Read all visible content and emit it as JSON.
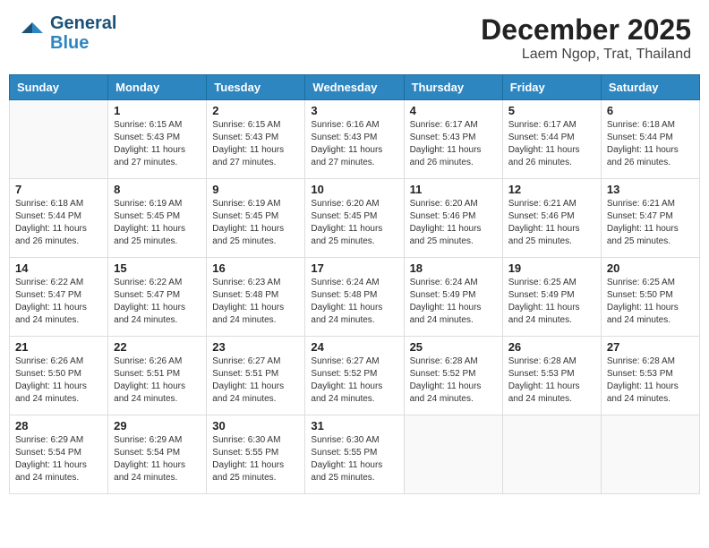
{
  "header": {
    "logo_line1": "General",
    "logo_line2": "Blue",
    "month_year": "December 2025",
    "location": "Laem Ngop, Trat, Thailand"
  },
  "days_of_week": [
    "Sunday",
    "Monday",
    "Tuesday",
    "Wednesday",
    "Thursday",
    "Friday",
    "Saturday"
  ],
  "weeks": [
    [
      {
        "day": "",
        "sunrise": "",
        "sunset": "",
        "daylight": ""
      },
      {
        "day": "1",
        "sunrise": "6:15 AM",
        "sunset": "5:43 PM",
        "daylight": "11 hours and 27 minutes."
      },
      {
        "day": "2",
        "sunrise": "6:15 AM",
        "sunset": "5:43 PM",
        "daylight": "11 hours and 27 minutes."
      },
      {
        "day": "3",
        "sunrise": "6:16 AM",
        "sunset": "5:43 PM",
        "daylight": "11 hours and 27 minutes."
      },
      {
        "day": "4",
        "sunrise": "6:17 AM",
        "sunset": "5:43 PM",
        "daylight": "11 hours and 26 minutes."
      },
      {
        "day": "5",
        "sunrise": "6:17 AM",
        "sunset": "5:44 PM",
        "daylight": "11 hours and 26 minutes."
      },
      {
        "day": "6",
        "sunrise": "6:18 AM",
        "sunset": "5:44 PM",
        "daylight": "11 hours and 26 minutes."
      }
    ],
    [
      {
        "day": "7",
        "sunrise": "6:18 AM",
        "sunset": "5:44 PM",
        "daylight": "11 hours and 26 minutes."
      },
      {
        "day": "8",
        "sunrise": "6:19 AM",
        "sunset": "5:45 PM",
        "daylight": "11 hours and 25 minutes."
      },
      {
        "day": "9",
        "sunrise": "6:19 AM",
        "sunset": "5:45 PM",
        "daylight": "11 hours and 25 minutes."
      },
      {
        "day": "10",
        "sunrise": "6:20 AM",
        "sunset": "5:45 PM",
        "daylight": "11 hours and 25 minutes."
      },
      {
        "day": "11",
        "sunrise": "6:20 AM",
        "sunset": "5:46 PM",
        "daylight": "11 hours and 25 minutes."
      },
      {
        "day": "12",
        "sunrise": "6:21 AM",
        "sunset": "5:46 PM",
        "daylight": "11 hours and 25 minutes."
      },
      {
        "day": "13",
        "sunrise": "6:21 AM",
        "sunset": "5:47 PM",
        "daylight": "11 hours and 25 minutes."
      }
    ],
    [
      {
        "day": "14",
        "sunrise": "6:22 AM",
        "sunset": "5:47 PM",
        "daylight": "11 hours and 24 minutes."
      },
      {
        "day": "15",
        "sunrise": "6:22 AM",
        "sunset": "5:47 PM",
        "daylight": "11 hours and 24 minutes."
      },
      {
        "day": "16",
        "sunrise": "6:23 AM",
        "sunset": "5:48 PM",
        "daylight": "11 hours and 24 minutes."
      },
      {
        "day": "17",
        "sunrise": "6:24 AM",
        "sunset": "5:48 PM",
        "daylight": "11 hours and 24 minutes."
      },
      {
        "day": "18",
        "sunrise": "6:24 AM",
        "sunset": "5:49 PM",
        "daylight": "11 hours and 24 minutes."
      },
      {
        "day": "19",
        "sunrise": "6:25 AM",
        "sunset": "5:49 PM",
        "daylight": "11 hours and 24 minutes."
      },
      {
        "day": "20",
        "sunrise": "6:25 AM",
        "sunset": "5:50 PM",
        "daylight": "11 hours and 24 minutes."
      }
    ],
    [
      {
        "day": "21",
        "sunrise": "6:26 AM",
        "sunset": "5:50 PM",
        "daylight": "11 hours and 24 minutes."
      },
      {
        "day": "22",
        "sunrise": "6:26 AM",
        "sunset": "5:51 PM",
        "daylight": "11 hours and 24 minutes."
      },
      {
        "day": "23",
        "sunrise": "6:27 AM",
        "sunset": "5:51 PM",
        "daylight": "11 hours and 24 minutes."
      },
      {
        "day": "24",
        "sunrise": "6:27 AM",
        "sunset": "5:52 PM",
        "daylight": "11 hours and 24 minutes."
      },
      {
        "day": "25",
        "sunrise": "6:28 AM",
        "sunset": "5:52 PM",
        "daylight": "11 hours and 24 minutes."
      },
      {
        "day": "26",
        "sunrise": "6:28 AM",
        "sunset": "5:53 PM",
        "daylight": "11 hours and 24 minutes."
      },
      {
        "day": "27",
        "sunrise": "6:28 AM",
        "sunset": "5:53 PM",
        "daylight": "11 hours and 24 minutes."
      }
    ],
    [
      {
        "day": "28",
        "sunrise": "6:29 AM",
        "sunset": "5:54 PM",
        "daylight": "11 hours and 24 minutes."
      },
      {
        "day": "29",
        "sunrise": "6:29 AM",
        "sunset": "5:54 PM",
        "daylight": "11 hours and 24 minutes."
      },
      {
        "day": "30",
        "sunrise": "6:30 AM",
        "sunset": "5:55 PM",
        "daylight": "11 hours and 25 minutes."
      },
      {
        "day": "31",
        "sunrise": "6:30 AM",
        "sunset": "5:55 PM",
        "daylight": "11 hours and 25 minutes."
      },
      {
        "day": "",
        "sunrise": "",
        "sunset": "",
        "daylight": ""
      },
      {
        "day": "",
        "sunrise": "",
        "sunset": "",
        "daylight": ""
      },
      {
        "day": "",
        "sunrise": "",
        "sunset": "",
        "daylight": ""
      }
    ]
  ]
}
